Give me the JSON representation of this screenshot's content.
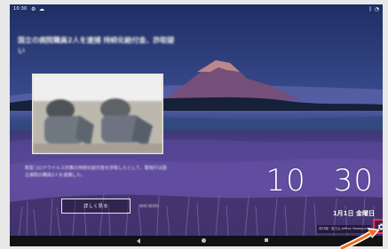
{
  "status_bar": {
    "time": "10:30",
    "left_icon_1": "gear-icon",
    "left_icon_2": "cloud-icon",
    "right_icons": [
      "bluetooth-icon",
      "wifi-icon"
    ]
  },
  "news": {
    "title": "国立の病院職員2人を逮捕 持続化給付金、詐取疑い",
    "body": "新型コロナウイルス対策の持続化給付金を詐取したとして、警視庁は国立病院の職員2人を逮捕した。",
    "read_more_label": "詳しく見る",
    "source": "NHK NEWS"
  },
  "clock": {
    "hour": "10",
    "minute": "30",
    "date": "1月1日 金曜日"
  },
  "credit": {
    "text": "河口湖・富士山 Jeffrey Yamaguchi"
  },
  "settings": {
    "icon": "gear-icon"
  },
  "nav": {
    "back": "back-icon",
    "home": "home-icon",
    "recent": "recent-apps-icon"
  },
  "colors": {
    "highlight": "#ff2f3a",
    "pointer": "#f46b12"
  }
}
